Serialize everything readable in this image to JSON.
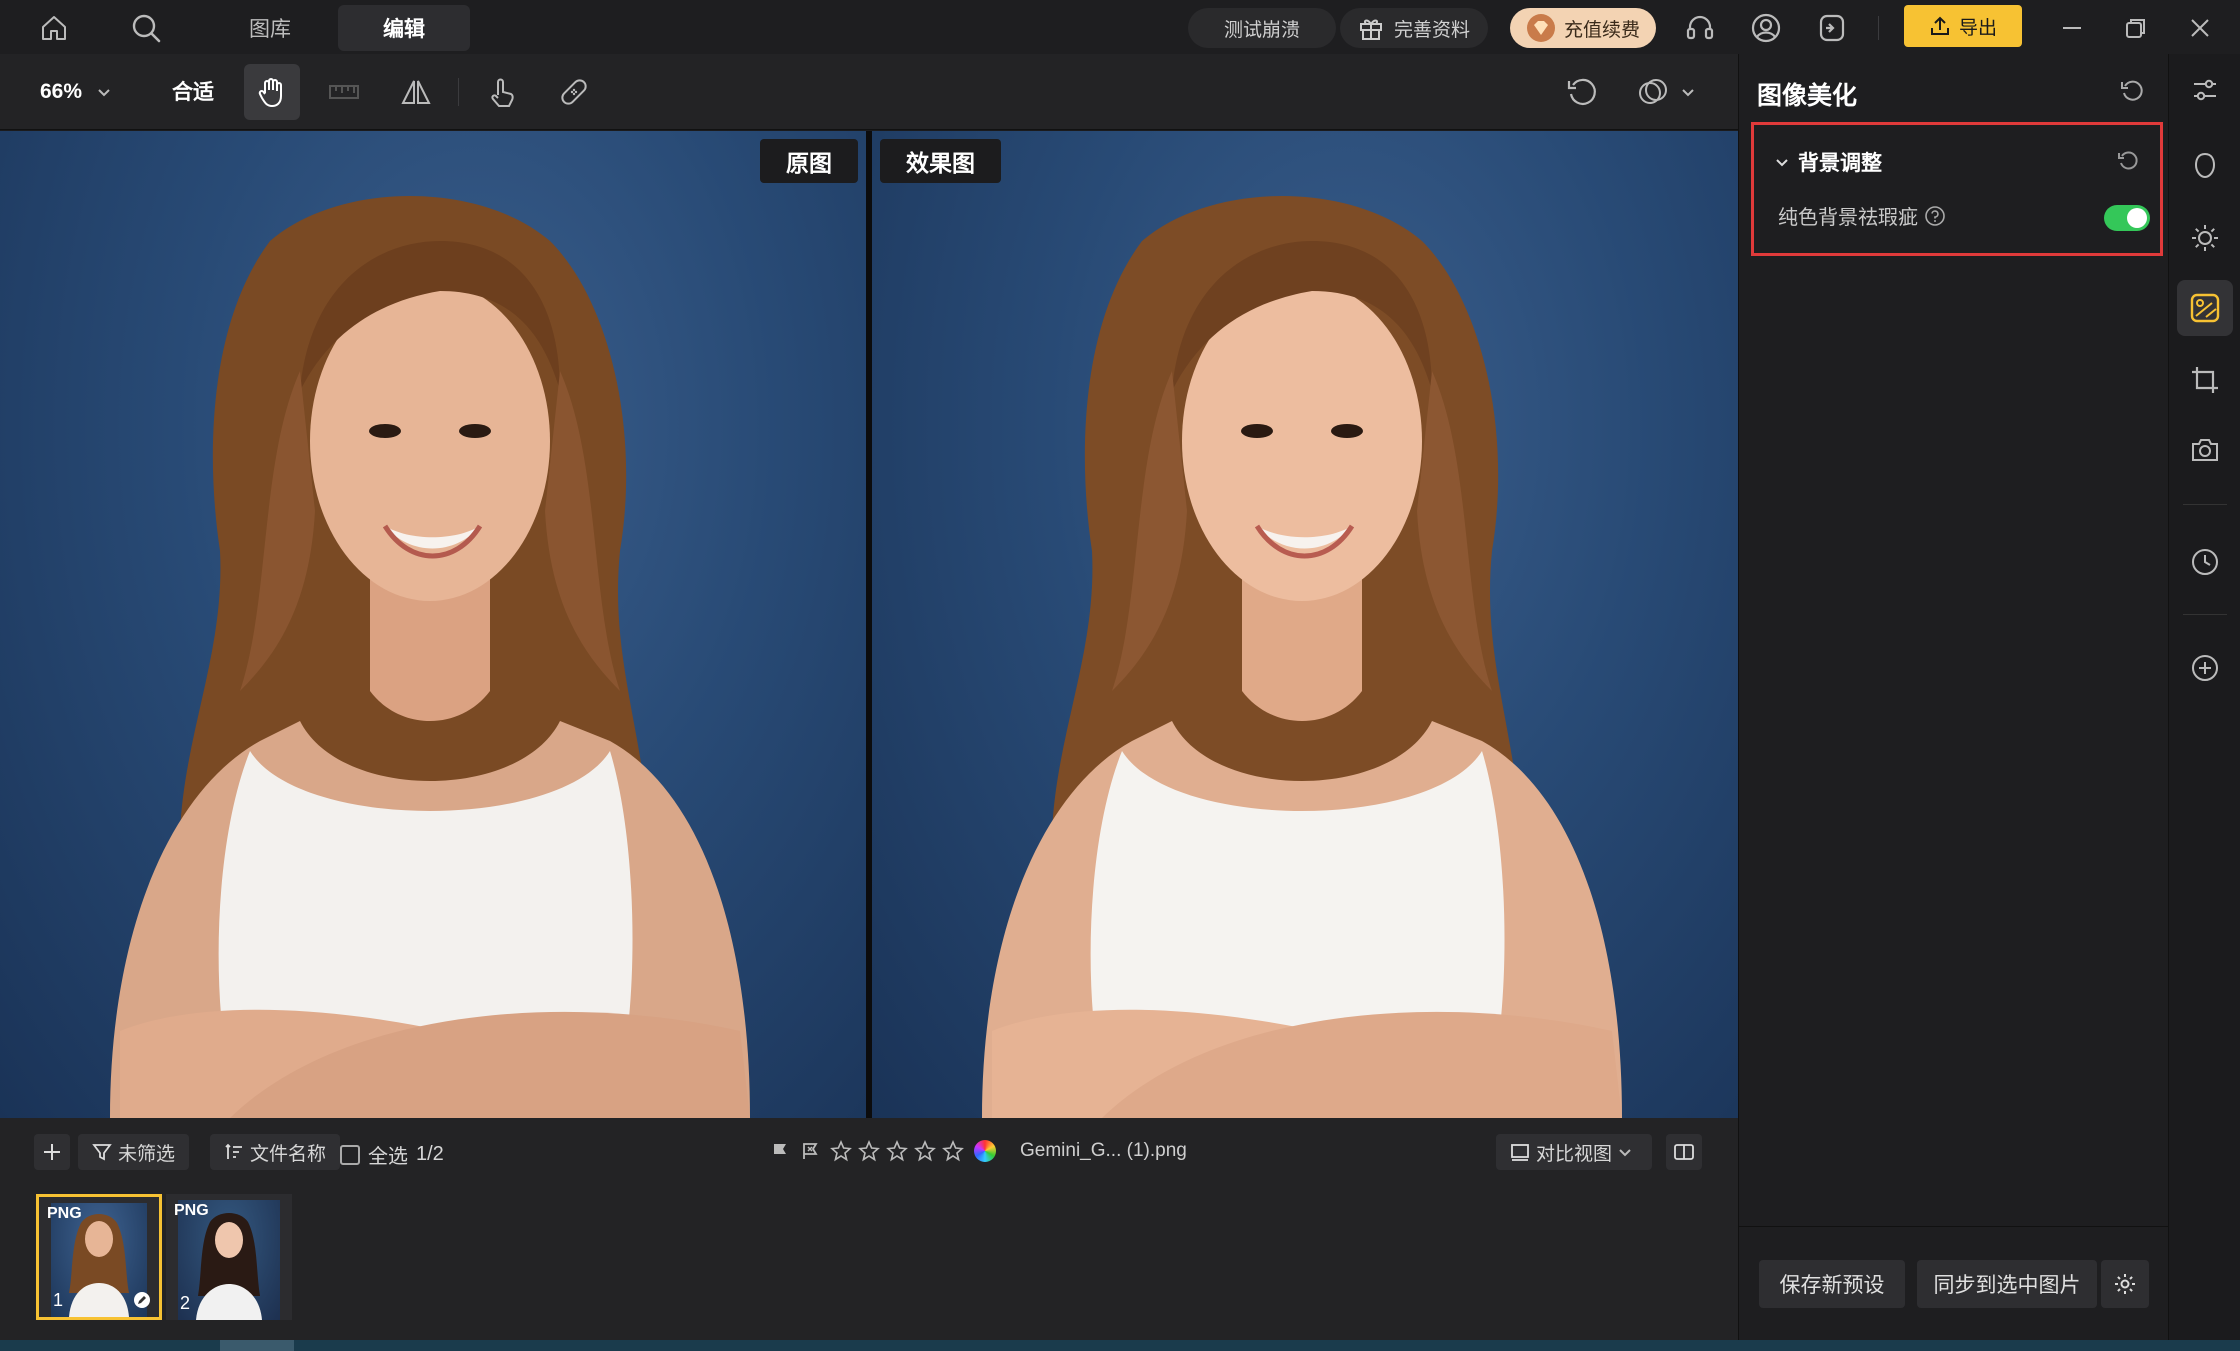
{
  "titlebar": {
    "tabs": [
      {
        "label": "图库",
        "active": false
      },
      {
        "label": "编辑",
        "active": true
      }
    ],
    "pills": {
      "test_crash": "测试崩溃",
      "complete_profile": "完善资料",
      "recharge": "充值续费"
    },
    "export_label": "导出"
  },
  "toolbar": {
    "zoom": "66%",
    "fit_label": "合适"
  },
  "canvas": {
    "original_label": "原图",
    "effect_label": "效果图"
  },
  "filmbar": {
    "filter_label": "未筛选",
    "sort_label": "文件名称",
    "select_all_label": "全选",
    "selection_count": "1/2",
    "filename": "Gemini_G... (1).png",
    "rating": 0,
    "view_mode": "对比视图",
    "thumbnails": [
      {
        "badge": "PNG",
        "index": "1",
        "selected": true
      },
      {
        "badge": "PNG",
        "index": "2",
        "selected": false
      }
    ]
  },
  "panel": {
    "title": "图像美化",
    "section_title": "背景调整",
    "toggle_label": "纯色背景祛瑕疵",
    "toggle_on": true,
    "save_preset": "保存新预设",
    "sync_selected": "同步到选中图片"
  },
  "colors": {
    "accent": "#f7c233",
    "toggle_green": "#34c759",
    "highlight_red": "#e03a3a",
    "recharge_pill": "#f3d3b3"
  }
}
